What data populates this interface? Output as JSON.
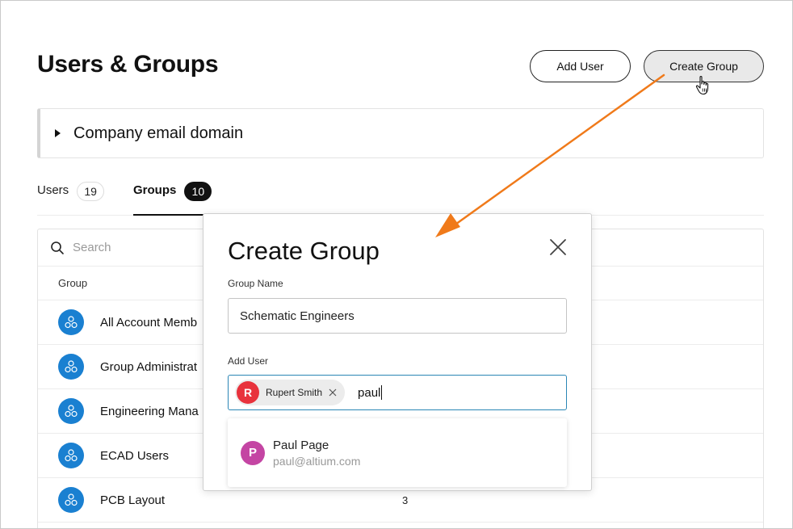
{
  "header": {
    "title": "Users & Groups",
    "add_user_label": "Add User",
    "create_group_label": "Create Group"
  },
  "domain_panel": {
    "label": "Company email domain"
  },
  "tabs": [
    {
      "label": "Users",
      "count": "19"
    },
    {
      "label": "Groups",
      "count": "10",
      "active": true
    }
  ],
  "table": {
    "search_placeholder": "Search",
    "columns": [
      "Group"
    ],
    "rows": [
      {
        "name": "All Account Memb",
        "count": ""
      },
      {
        "name": "Group Administrat",
        "count": ""
      },
      {
        "name": "Engineering Mana",
        "count": ""
      },
      {
        "name": "ECAD Users",
        "count": ""
      },
      {
        "name": "PCB Layout",
        "count": "3"
      }
    ]
  },
  "modal": {
    "title": "Create Group",
    "group_name_label": "Group Name",
    "group_name_value": "Schematic Engineers",
    "add_user_label": "Add User",
    "selected_user": {
      "initial": "R",
      "name": "Rupert Smith"
    },
    "typed_text": "paul",
    "suggestion": {
      "initial": "P",
      "name": "Paul Page",
      "email": "paul@altium.com"
    }
  },
  "colors": {
    "accent_arrow": "#f07a1a",
    "group_avatar": "#1a80d1",
    "chip_avatar": "#e8323c",
    "suggestion_avatar": "#c445a3",
    "input_focus": "#2b86b5"
  },
  "icons": {
    "search": "search-icon",
    "close": "close-icon",
    "chip_remove": "x-icon",
    "group": "group-icon",
    "caret": "caret-right-icon",
    "pointer": "hand-pointer-icon"
  }
}
